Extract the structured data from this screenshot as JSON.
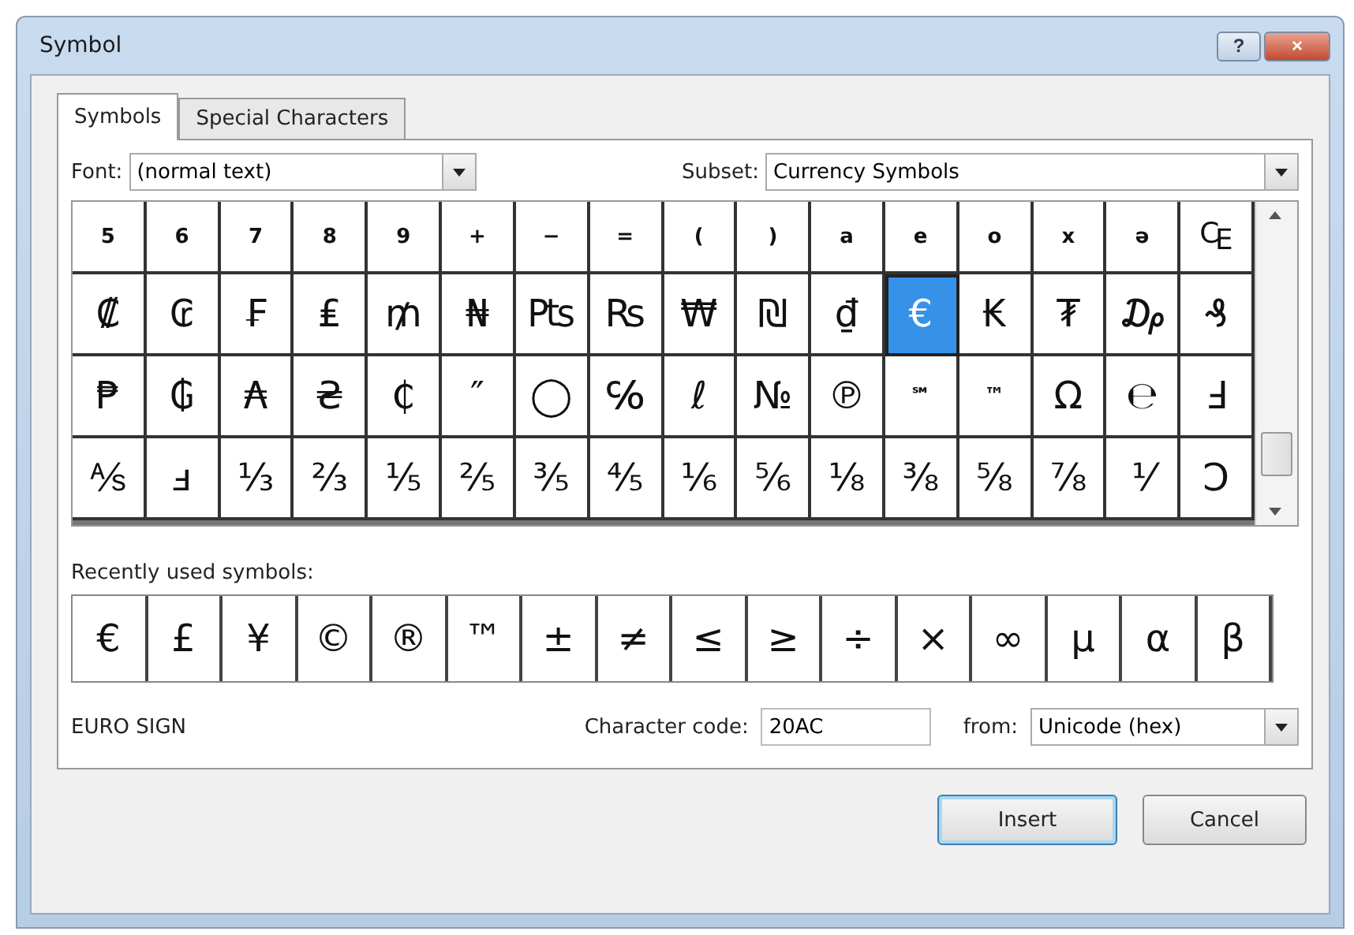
{
  "window": {
    "title": "Symbol",
    "help": "?",
    "close": "×"
  },
  "tabs": [
    {
      "label": "Symbols",
      "selected": true
    },
    {
      "label": "Special Characters",
      "selected": false
    }
  ],
  "font": {
    "label": "Font:",
    "value": "(normal text)"
  },
  "subset": {
    "label": "Subset:",
    "value": "Currency Symbols"
  },
  "grid": [
    {
      "cells": [
        {
          "char": "5",
          "small": true,
          "selected": false
        },
        {
          "char": "6",
          "small": true,
          "selected": false
        },
        {
          "char": "7",
          "small": true,
          "selected": false
        },
        {
          "char": "8",
          "small": true,
          "selected": false
        },
        {
          "char": "9",
          "small": true,
          "selected": false
        },
        {
          "char": "+",
          "small": true,
          "selected": false
        },
        {
          "char": "−",
          "small": true,
          "selected": false
        },
        {
          "char": "=",
          "small": true,
          "selected": false
        },
        {
          "char": "(",
          "small": true,
          "selected": false
        },
        {
          "char": ")",
          "small": true,
          "selected": false
        },
        {
          "char": "a",
          "small": true,
          "selected": false
        },
        {
          "char": "e",
          "small": true,
          "selected": false
        },
        {
          "char": "o",
          "small": true,
          "selected": false
        },
        {
          "char": "x",
          "small": true,
          "selected": false
        },
        {
          "char": "ə",
          "small": true,
          "selected": false
        },
        {
          "char": "₠",
          "small": false,
          "selected": false
        }
      ]
    },
    {
      "cells": [
        {
          "char": "₡",
          "small": false,
          "selected": false
        },
        {
          "char": "₢",
          "small": false,
          "selected": false
        },
        {
          "char": "₣",
          "small": false,
          "selected": false
        },
        {
          "char": "₤",
          "small": false,
          "selected": false
        },
        {
          "char": "₥",
          "small": false,
          "selected": false
        },
        {
          "char": "₦",
          "small": false,
          "selected": false
        },
        {
          "char": "₧",
          "small": false,
          "selected": false
        },
        {
          "char": "₨",
          "small": false,
          "selected": false
        },
        {
          "char": "₩",
          "small": false,
          "selected": false
        },
        {
          "char": "₪",
          "small": false,
          "selected": false
        },
        {
          "char": "₫",
          "small": false,
          "selected": false
        },
        {
          "char": "€",
          "small": false,
          "selected": true
        },
        {
          "char": "₭",
          "small": false,
          "selected": false
        },
        {
          "char": "₮",
          "small": false,
          "selected": false
        },
        {
          "char": "₯",
          "small": false,
          "selected": false
        },
        {
          "char": "₰",
          "small": false,
          "selected": false
        }
      ]
    },
    {
      "cells": [
        {
          "char": "₱",
          "small": false,
          "selected": false
        },
        {
          "char": "₲",
          "small": false,
          "selected": false
        },
        {
          "char": "₳",
          "small": false,
          "selected": false
        },
        {
          "char": "₴",
          "small": false,
          "selected": false
        },
        {
          "char": "₵",
          "small": false,
          "selected": false
        },
        {
          "char": "″",
          "small": false,
          "selected": false
        },
        {
          "char": "◯",
          "small": false,
          "selected": false
        },
        {
          "char": "℅",
          "small": false,
          "selected": false
        },
        {
          "char": "ℓ",
          "small": false,
          "selected": false
        },
        {
          "char": "№",
          "small": false,
          "selected": false
        },
        {
          "char": "℗",
          "small": false,
          "selected": false
        },
        {
          "char": "℠",
          "small": true,
          "selected": false
        },
        {
          "char": "™",
          "small": true,
          "selected": false
        },
        {
          "char": "Ω",
          "small": false,
          "selected": false
        },
        {
          "char": "℮",
          "small": false,
          "selected": false
        },
        {
          "char": "Ⅎ",
          "small": false,
          "selected": false
        }
      ]
    },
    {
      "cells": [
        {
          "char": "⅍",
          "small": false,
          "selected": false
        },
        {
          "char": "ⅎ",
          "small": false,
          "selected": false
        },
        {
          "char": "⅓",
          "small": false,
          "selected": false
        },
        {
          "char": "⅔",
          "small": false,
          "selected": false
        },
        {
          "char": "⅕",
          "small": false,
          "selected": false
        },
        {
          "char": "⅖",
          "small": false,
          "selected": false
        },
        {
          "char": "⅗",
          "small": false,
          "selected": false
        },
        {
          "char": "⅘",
          "small": false,
          "selected": false
        },
        {
          "char": "⅙",
          "small": false,
          "selected": false
        },
        {
          "char": "⅚",
          "small": false,
          "selected": false
        },
        {
          "char": "⅛",
          "small": false,
          "selected": false
        },
        {
          "char": "⅜",
          "small": false,
          "selected": false
        },
        {
          "char": "⅝",
          "small": false,
          "selected": false
        },
        {
          "char": "⅞",
          "small": false,
          "selected": false
        },
        {
          "char": "⅟",
          "small": false,
          "selected": false
        },
        {
          "char": "Ↄ",
          "small": false,
          "selected": false
        }
      ]
    }
  ],
  "recent": {
    "label": "Recently used symbols:",
    "symbols": [
      "€",
      "£",
      "¥",
      "©",
      "®",
      "™",
      "±",
      "≠",
      "≤",
      "≥",
      "÷",
      "×",
      "∞",
      "µ",
      "α",
      "β"
    ]
  },
  "character_name": "EURO SIGN",
  "character_code": {
    "label": "Character code:",
    "value": "20AC"
  },
  "from": {
    "label": "from:",
    "value": "Unicode (hex)"
  },
  "buttons": [
    {
      "label": "Insert",
      "default": true
    },
    {
      "label": "Cancel",
      "default": false
    }
  ]
}
